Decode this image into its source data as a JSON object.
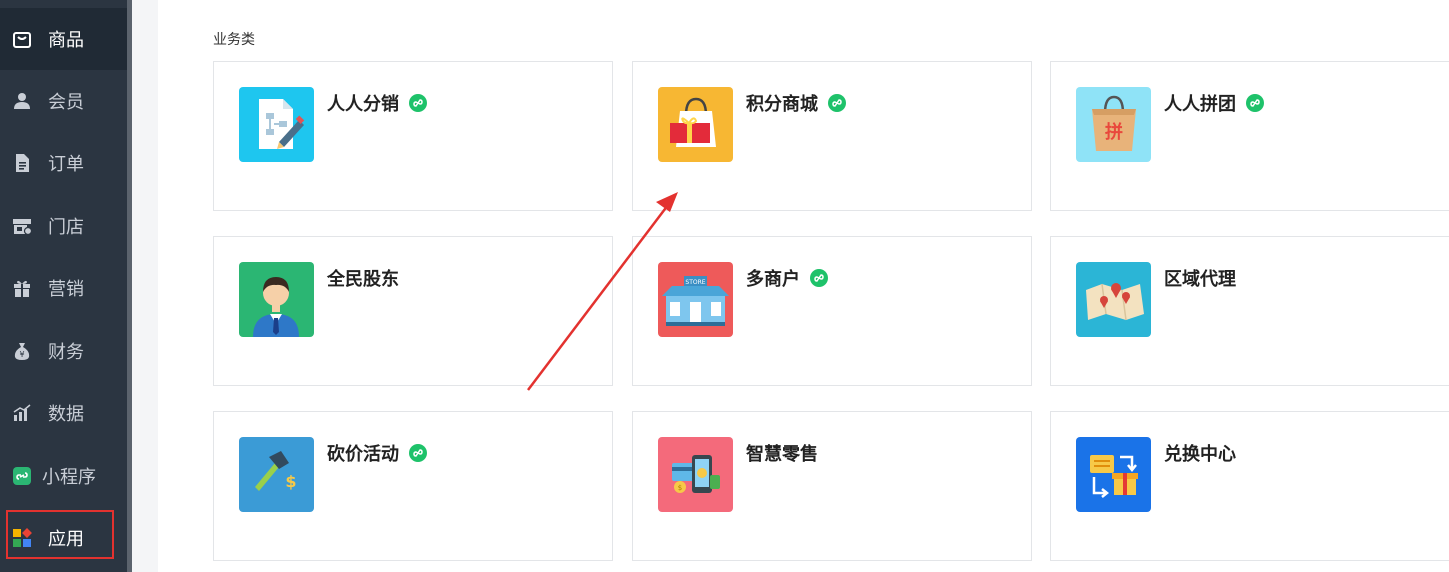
{
  "sidebar": {
    "items": [
      {
        "label": "商品",
        "icon": "bag-icon"
      },
      {
        "label": "会员",
        "icon": "user-icon"
      },
      {
        "label": "订单",
        "icon": "document-icon"
      },
      {
        "label": "门店",
        "icon": "store-icon"
      },
      {
        "label": "营销",
        "icon": "gift-icon"
      },
      {
        "label": "财务",
        "icon": "money-bag-icon"
      },
      {
        "label": "数据",
        "icon": "bar-chart-icon"
      },
      {
        "label": "小程序",
        "icon": "mini-program-icon"
      },
      {
        "label": "应用",
        "icon": "apps-icon"
      }
    ]
  },
  "main": {
    "section_title": "业务类",
    "cards": [
      {
        "title": "人人分销",
        "icon": "distribution-icon",
        "mini_program": true,
        "tile_color": "#1ec6ef"
      },
      {
        "title": "积分商城",
        "icon": "points-mall-icon",
        "mini_program": true,
        "tile_color": "#f7b733"
      },
      {
        "title": "人人拼团",
        "icon": "group-buy-icon",
        "mini_program": true,
        "tile_color": "#8fe3f7"
      },
      {
        "title": "全民股东",
        "icon": "shareholder-icon",
        "mini_program": false,
        "tile_color": "#2bb673"
      },
      {
        "title": "多商户",
        "icon": "multi-merchant-icon",
        "mini_program": true,
        "tile_color": "#ee5a5a"
      },
      {
        "title": "区域代理",
        "icon": "regional-agent-icon",
        "mini_program": false,
        "tile_color": "#2bb5d6"
      },
      {
        "title": "砍价活动",
        "icon": "bargain-icon",
        "mini_program": true,
        "tile_color": "#3b9bd6"
      },
      {
        "title": "智慧零售",
        "icon": "smart-retail-icon",
        "mini_program": false,
        "tile_color": "#f46a7b"
      },
      {
        "title": "兑换中心",
        "icon": "exchange-center-icon",
        "mini_program": false,
        "tile_color": "#1a73e8"
      }
    ]
  },
  "colors": {
    "sidebar_bg": "#2b3541",
    "highlight_border": "#e3322f",
    "arrow": "#e3322f",
    "mini_program_badge": "#1ec26a"
  }
}
